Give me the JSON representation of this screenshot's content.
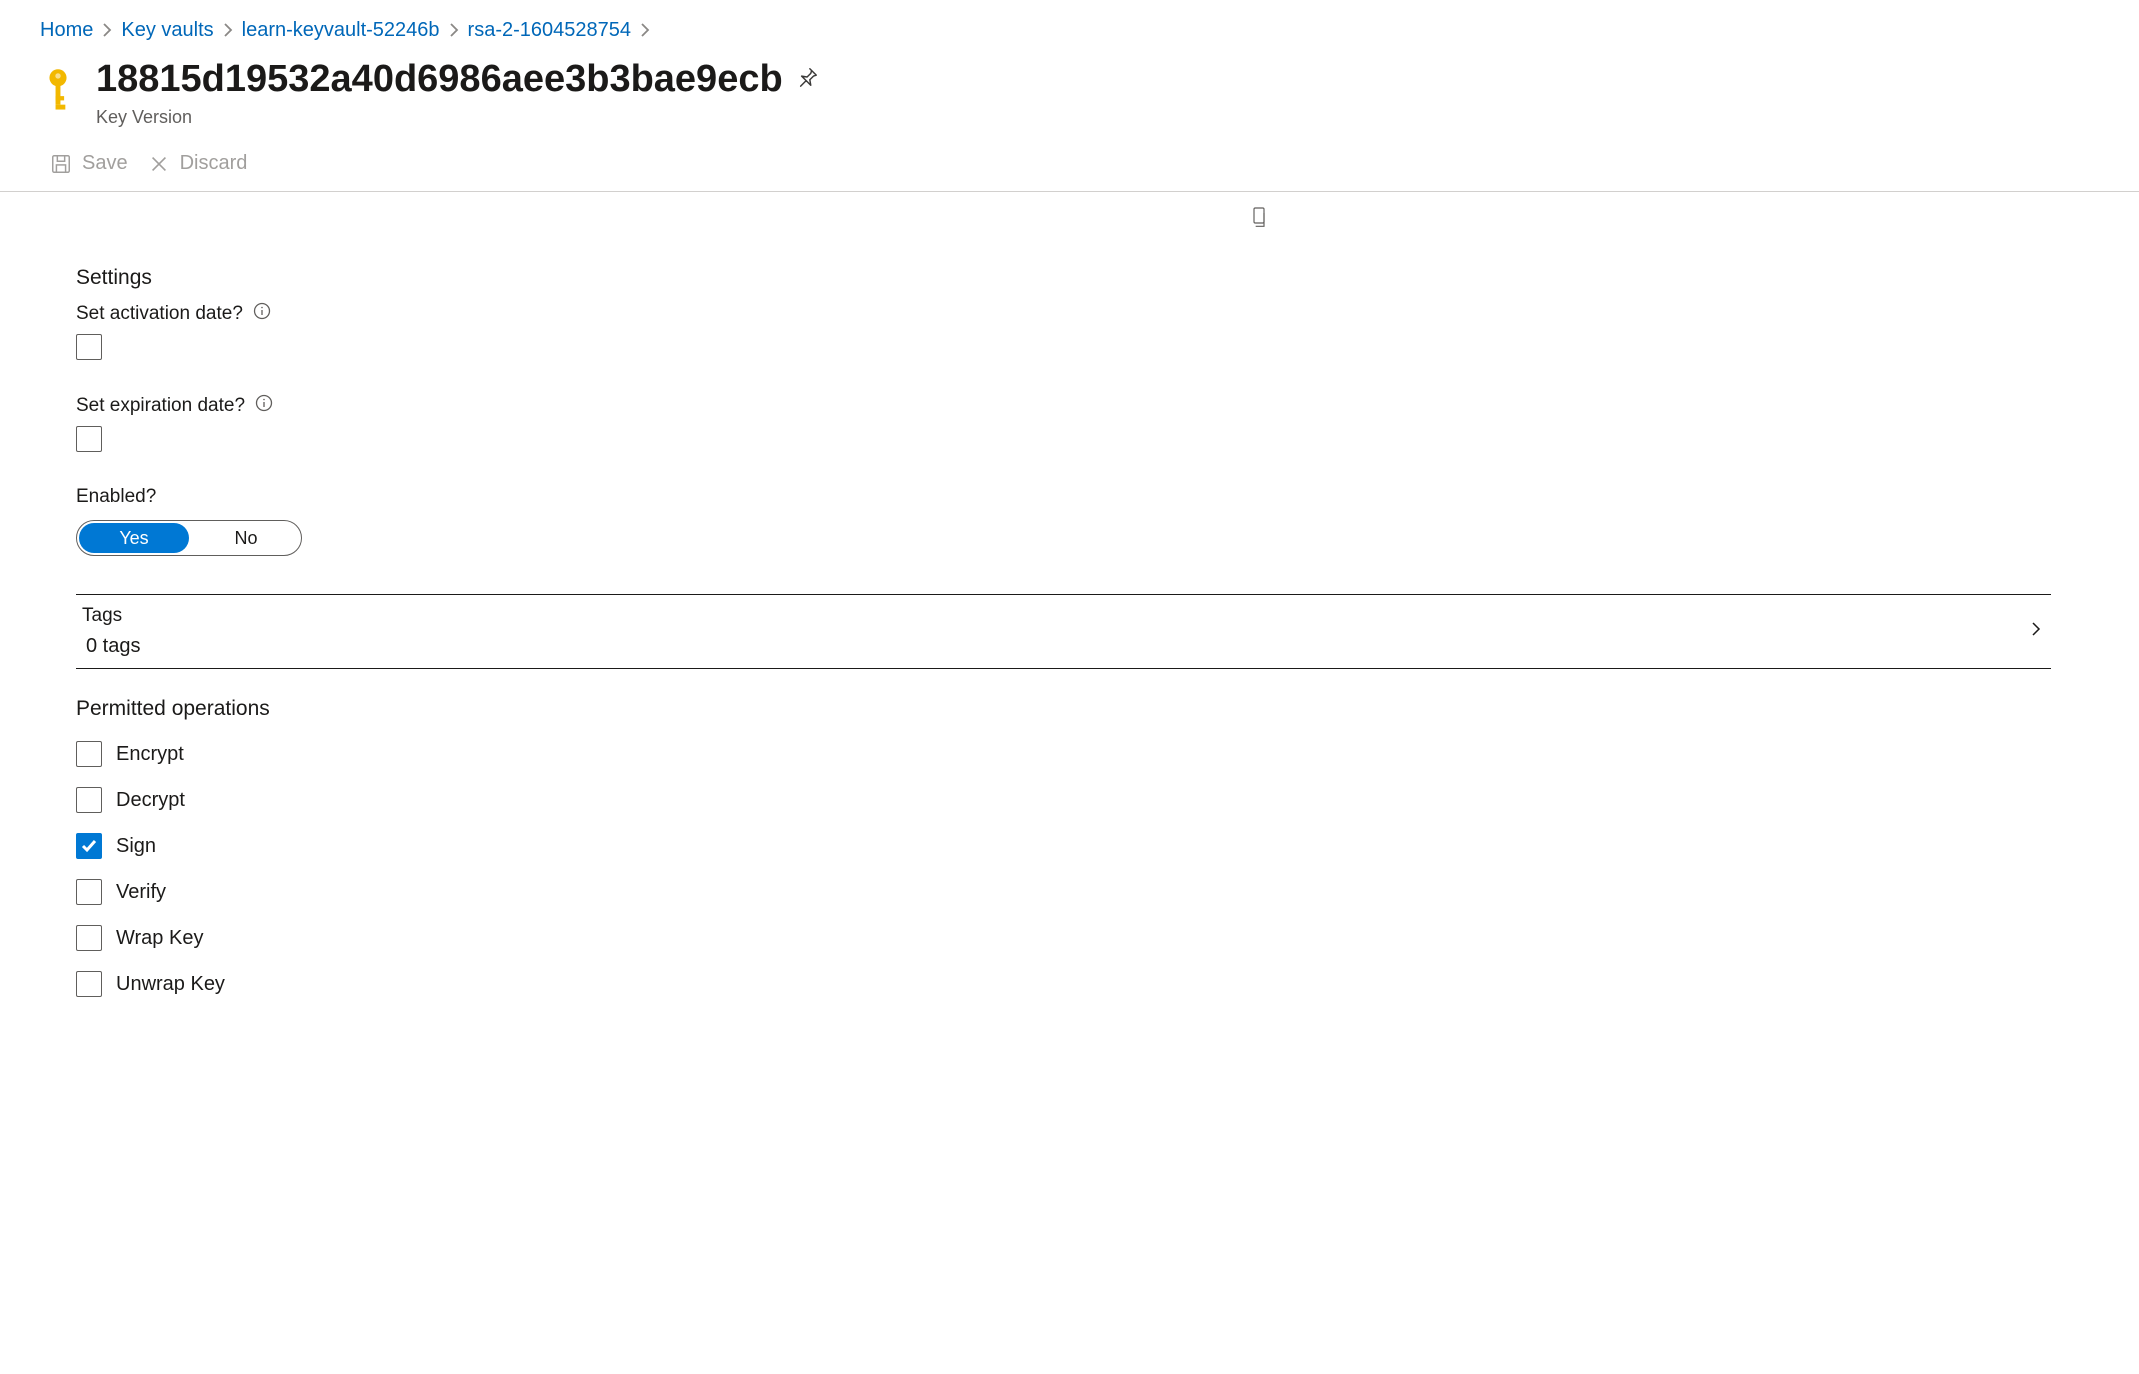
{
  "breadcrumb": {
    "items": [
      "Home",
      "Key vaults",
      "learn-keyvault-52246b",
      "rsa-2-1604528754"
    ]
  },
  "header": {
    "title": "18815d19532a40d6986aee3b3bae9ecb",
    "subtitle": "Key Version"
  },
  "toolbar": {
    "save": "Save",
    "discard": "Discard"
  },
  "settings": {
    "section_title": "Settings",
    "activation_label": "Set activation date?",
    "activation_checked": false,
    "expiration_label": "Set expiration date?",
    "expiration_checked": false,
    "enabled_label": "Enabled?",
    "enabled_options": {
      "yes": "Yes",
      "no": "No"
    },
    "enabled_value": "Yes"
  },
  "tags": {
    "title": "Tags",
    "value": "0 tags"
  },
  "permitted": {
    "title": "Permitted operations",
    "ops": [
      {
        "label": "Encrypt",
        "checked": false
      },
      {
        "label": "Decrypt",
        "checked": false
      },
      {
        "label": "Sign",
        "checked": true
      },
      {
        "label": "Verify",
        "checked": false
      },
      {
        "label": "Wrap Key",
        "checked": false
      },
      {
        "label": "Unwrap Key",
        "checked": false
      }
    ]
  }
}
